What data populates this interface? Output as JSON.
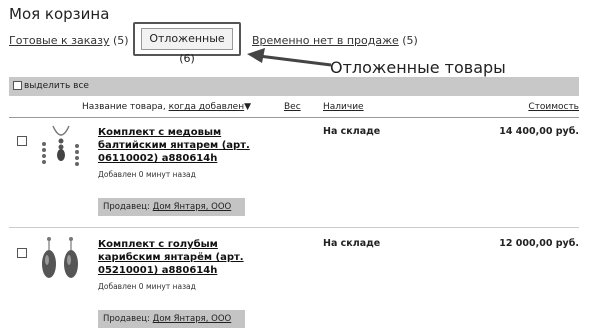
{
  "page": {
    "title": "Моя корзина"
  },
  "tabs": {
    "ready": {
      "label": "Готовые к заказу",
      "count": "(5)"
    },
    "deferred": {
      "label": "Отложенные (6)"
    },
    "unavailable": {
      "label": "Временно нет в продаже",
      "count": "(5)"
    }
  },
  "annotation": {
    "label": "Отложенные товары"
  },
  "select_all": {
    "label": "выделить все"
  },
  "table_header": {
    "name": "Название товара,",
    "added_sort": "когда добавлен",
    "sort_arrow": "▼",
    "weight": "Вес",
    "availability": "Наличие",
    "price": "Стоимость"
  },
  "items": [
    {
      "title": "Комплект с медовым балтийским янтарем (арт. 06110002) а880614h",
      "added": "Добавлен 0 минут назад",
      "seller_prefix": "Продавец:",
      "seller": "Дом Янтаря, ООО",
      "availability": "На складе",
      "price": "14 400,00 руб."
    },
    {
      "title": "Комплект с голубым карибским янтарём (арт. 05210001) а880614h",
      "added": "Добавлен 0 минут назад",
      "seller_prefix": "Продавец:",
      "seller": "Дом Янтаря, ООО",
      "availability": "На складе",
      "price": "12 000,00 руб."
    }
  ]
}
